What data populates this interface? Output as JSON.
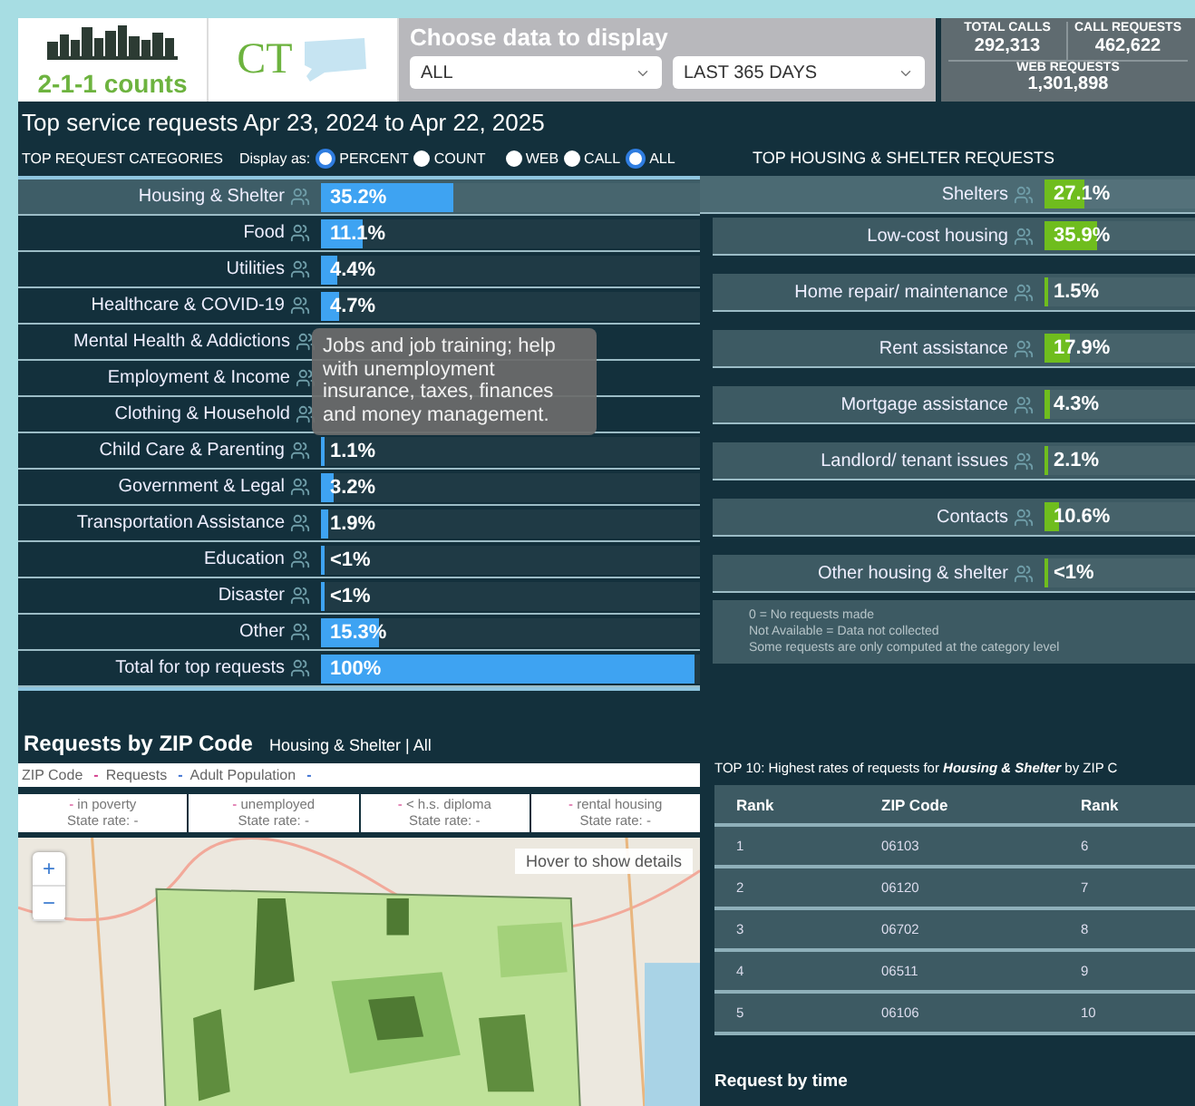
{
  "header": {
    "logo": "2-1-1 counts",
    "state": "CT",
    "chooser": {
      "title": "Choose data to display",
      "selects": [
        "ALL",
        "LAST 365 DAYS"
      ]
    },
    "stats": [
      {
        "label": "TOTAL CALLS",
        "value": "292,313"
      },
      {
        "label": "CALL REQUESTS",
        "value": "462,622"
      },
      {
        "label": "WEB REQUESTS",
        "value": "1,301,898"
      }
    ]
  },
  "title": "Top service requests Apr 23, 2024 to Apr 22, 2025",
  "categories": {
    "heading": "TOP REQUEST CATEGORIES",
    "display_label": "Display as:",
    "display_options": [
      {
        "label": "PERCENT",
        "selected": true
      },
      {
        "label": "COUNT",
        "selected": false
      }
    ],
    "source_options": [
      {
        "label": "WEB",
        "selected": false
      },
      {
        "label": "CALL",
        "selected": false
      },
      {
        "label": "ALL",
        "selected": true
      }
    ],
    "rows": [
      {
        "label": "Housing & Shelter",
        "value": "35.2%",
        "level": 0.352,
        "selected": true
      },
      {
        "label": "Food",
        "value": "11.1%",
        "level": 0.111,
        "selected": false
      },
      {
        "label": "Utilities",
        "value": "4.4%",
        "level": 0.044,
        "selected": false
      },
      {
        "label": "Healthcare & COVID-19",
        "value": "4.7%",
        "level": 0.047,
        "selected": false
      },
      {
        "label": "Mental Health & Addictions",
        "selected": false
      },
      {
        "label": "Employment & Income",
        "selected": false
      },
      {
        "label": "Clothing & Household",
        "selected": false
      },
      {
        "label": "Child Care & Parenting",
        "value": "1.1%",
        "level": 0.011,
        "selected": false
      },
      {
        "label": "Government & Legal",
        "value": "3.2%",
        "level": 0.032,
        "selected": false
      },
      {
        "label": "Transportation Assistance",
        "value": "1.9%",
        "level": 0.019,
        "selected": false
      },
      {
        "label": "Education",
        "value": "<1%",
        "level": 0.005,
        "selected": false
      },
      {
        "label": "Disaster",
        "value": "<1%",
        "level": 0.005,
        "selected": false
      },
      {
        "label": "Other",
        "value": "15.3%",
        "level": 0.153,
        "selected": false
      },
      {
        "label": "Total for top requests",
        "value": "100%",
        "level": 1,
        "selected": false
      }
    ],
    "tooltip": "Jobs and job training; help with unemployment insurance, taxes, finances and money management."
  },
  "housing": {
    "heading": "TOP HOUSING & SHELTER REQUESTS",
    "rows": [
      {
        "label": "Shelters",
        "value": "27.1%",
        "level": 0.271,
        "selected": true
      },
      {
        "label": "Low-cost housing",
        "value": "35.9%",
        "level": 0.359,
        "selected": false
      },
      {
        "label": "Home repair/ maintenance",
        "value": "1.5%",
        "level": 0.015,
        "selected": false
      },
      {
        "label": "Rent assistance",
        "value": "17.9%",
        "level": 0.179,
        "selected": false
      },
      {
        "label": "Mortgage assistance",
        "value": "4.3%",
        "level": 0.043,
        "selected": false
      },
      {
        "label": "Landlord/ tenant issues",
        "value": "2.1%",
        "level": 0.021,
        "selected": false
      },
      {
        "label": "Contacts",
        "value": "10.6%",
        "level": 0.106,
        "selected": false
      },
      {
        "label": "Other housing & shelter",
        "value": "<1%",
        "level": 0.005,
        "selected": false
      }
    ],
    "notes": [
      "0 = No requests made",
      "Not Available = Data not collected",
      "Some requests are only computed at the category level"
    ]
  },
  "zip": {
    "title": "Requests by ZIP Code",
    "subtitle": "Housing & Shelter | All",
    "fields": [
      {
        "label": "ZIP Code",
        "value": "-",
        "color": "#d23a8a"
      },
      {
        "label": "Requests",
        "value": "-",
        "color": "#3a6fd2"
      },
      {
        "label": "Adult Population",
        "value": "-",
        "color": "#3a6fd2"
      }
    ],
    "rates": [
      {
        "value": "-",
        "label": "in poverty",
        "state_rate": "State rate: -"
      },
      {
        "value": "-",
        "label": "unemployed",
        "state_rate": "State rate: -"
      },
      {
        "value": "-",
        "label": "< h.s. diploma",
        "state_rate": "State rate: -"
      },
      {
        "value": "-",
        "label": "rental housing",
        "state_rate": "State rate: -"
      }
    ],
    "map": {
      "hint": "Hover to show details",
      "zoom_in": "+",
      "zoom_out": "−"
    }
  },
  "top10": {
    "caption": "TOP 10: Highest rates of requests for **Housing & Shelter** by ZIP C",
    "columns": [
      "Rank",
      "ZIP Code",
      "Rank"
    ],
    "rows": [
      [
        "1",
        "06103",
        "6"
      ],
      [
        "2",
        "06120",
        "7"
      ],
      [
        "3",
        "06702",
        "8"
      ],
      [
        "4",
        "06511",
        "9"
      ],
      [
        "5",
        "06106",
        "10"
      ]
    ]
  },
  "time_title": "Request by time"
}
